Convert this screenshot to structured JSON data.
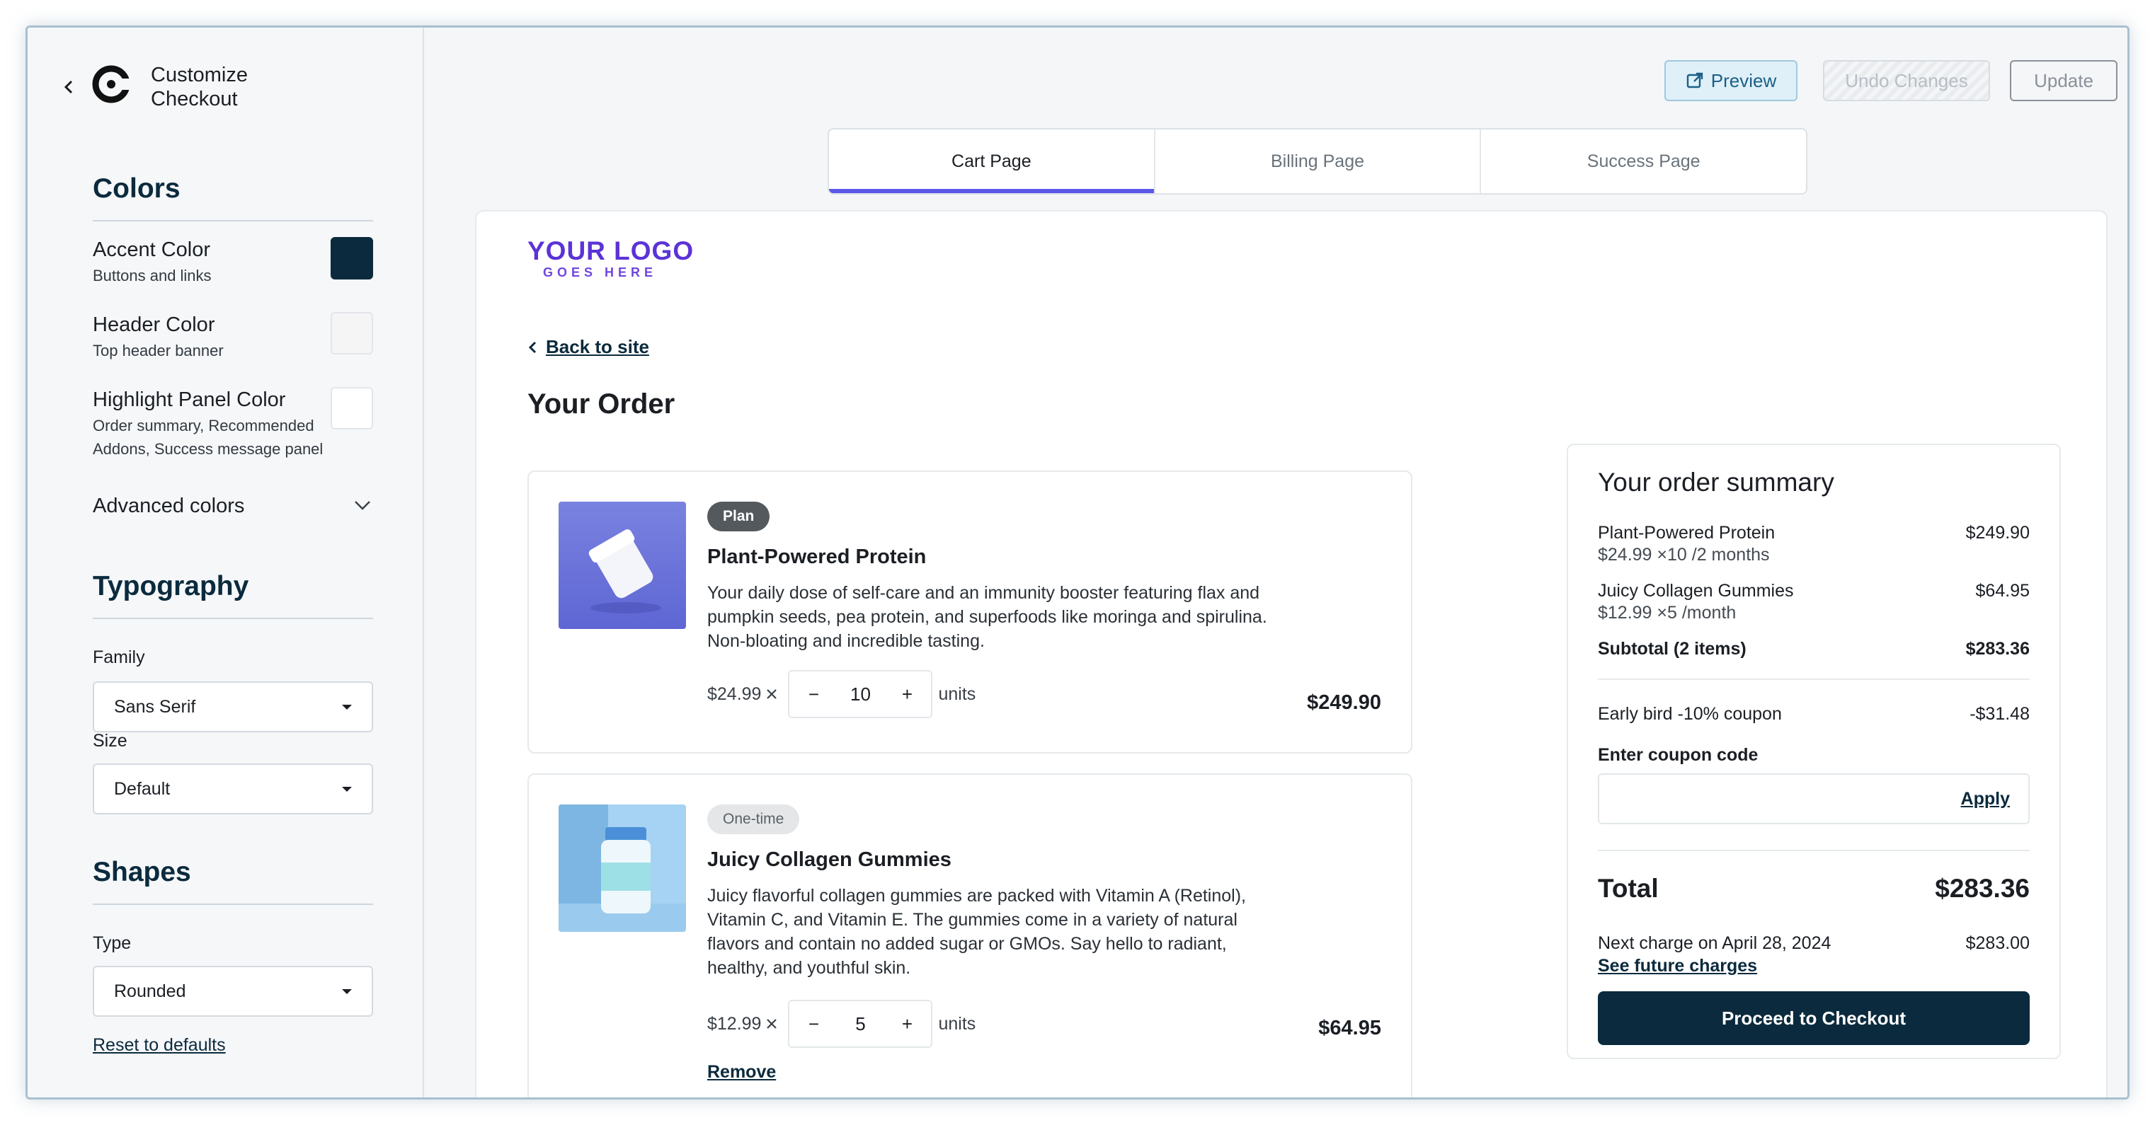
{
  "sidebar": {
    "title_line1": "Customize",
    "title_line2": "Checkout",
    "colors_heading": "Colors",
    "accent": {
      "label": "Accent Color",
      "sub": "Buttons and links",
      "value": "#0b2a3d"
    },
    "header": {
      "label": "Header Color",
      "sub": "Top header banner",
      "value": "#f5f5f5"
    },
    "highlight": {
      "label": "Highlight Panel Color",
      "sub": "Order summary, Recommended Addons, Success message panel",
      "value": "#ffffff"
    },
    "advanced_label": "Advanced colors",
    "typography_heading": "Typography",
    "family_label": "Family",
    "family_value": "Sans Serif",
    "size_label": "Size",
    "size_value": "Default",
    "shapes_heading": "Shapes",
    "type_label": "Type",
    "type_value": "Rounded",
    "reset_label": "Reset to defaults"
  },
  "toolbar": {
    "preview_label": "Preview",
    "undo_label": "Undo Changes",
    "update_label": "Update"
  },
  "tabs": [
    {
      "label": "Cart Page"
    },
    {
      "label": "Billing Page"
    },
    {
      "label": "Success Page"
    }
  ],
  "page": {
    "logo_line1": "YOUR LOGO",
    "logo_line2": "GOES HERE",
    "back_label": "Back to site",
    "order_heading": "Your Order"
  },
  "items": [
    {
      "badge": "Plan",
      "name": "Plant-Powered Protein",
      "description": "Your daily dose of self-care and an immunity booster featuring flax and pumpkin seeds, pea protein, and superfoods like moringa and spirulina. Non-bloating and incredible tasting.",
      "price": "$24.99",
      "quantity": "10",
      "units": "units",
      "total": "$249.90"
    },
    {
      "badge": "One-time",
      "name": "Juicy Collagen Gummies",
      "description": "Juicy flavorful collagen gummies are packed with Vitamin A (Retinol), Vitamin C, and Vitamin E. The gummies come in a variety of natural flavors and contain no added sugar or GMOs. Say hello to radiant, healthy, and youthful skin.",
      "price": "$12.99",
      "quantity": "5",
      "units": "units",
      "total": "$64.95",
      "remove_label": "Remove"
    }
  ],
  "summary": {
    "heading": "Your order summary",
    "line1": {
      "name": "Plant-Powered Protein",
      "detail": "$24.99 ×10 /2 months",
      "amount": "$249.90"
    },
    "line2": {
      "name": "Juicy Collagen Gummies",
      "detail": "$12.99 ×5 /month",
      "amount": "$64.95"
    },
    "subtotal": {
      "label": "Subtotal (2 items)",
      "amount": "$283.36"
    },
    "coupon": {
      "label": "Early bird -10% coupon",
      "amount": "-$31.48"
    },
    "coupon_input_label": "Enter coupon code",
    "coupon_input_value": "",
    "apply_label": "Apply",
    "total": {
      "label": "Total",
      "amount": "$283.36"
    },
    "next_charge": {
      "label": "Next charge on April 28, 2024",
      "amount": "$283.00"
    },
    "future_label": "See future charges",
    "checkout_label": "Proceed to Checkout"
  }
}
